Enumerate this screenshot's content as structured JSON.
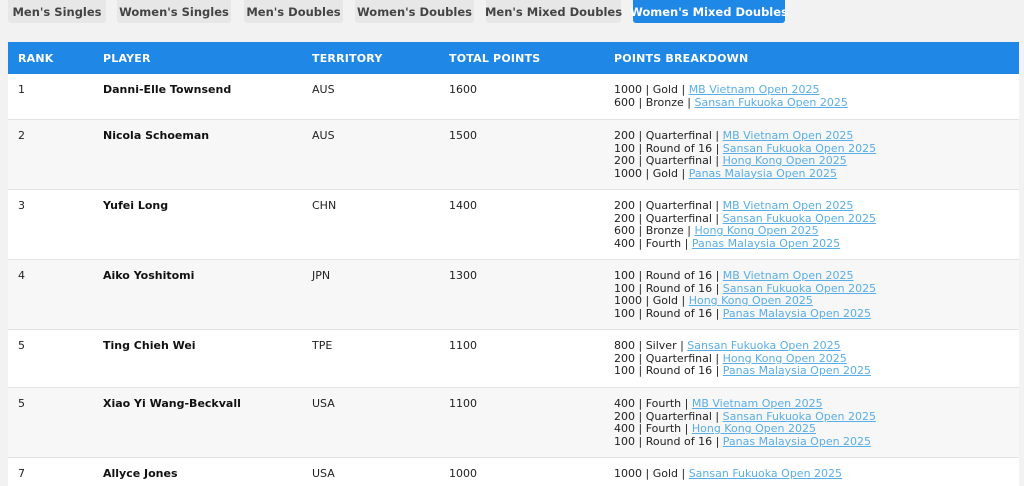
{
  "tabs": [
    {
      "label": "Men's Singles"
    },
    {
      "label": "Women's Singles"
    },
    {
      "label": "Men's Doubles"
    },
    {
      "label": "Women's Doubles"
    },
    {
      "label": "Men's Mixed Doubles"
    },
    {
      "label": "Women's Mixed Doubles"
    }
  ],
  "active_tab": "Women's Mixed Doubles",
  "colors": {
    "accent": "#1f87e5",
    "link": "#5aaee6"
  },
  "table": {
    "headers": {
      "rank": "RANK",
      "player": "PLAYER",
      "territory": "TERRITORY",
      "total_points": "TOTAL POINTS",
      "breakdown": "POINTS BREAKDOWN"
    },
    "rows": [
      {
        "rank": "1",
        "player": "Danni-Elle Townsend",
        "territory": "AUS",
        "total_points": "1600",
        "breakdown": [
          {
            "text": "1000 | Gold | ",
            "link": "MB Vietnam Open 2025"
          },
          {
            "text": "600 | Bronze | ",
            "link": "Sansan Fukuoka Open 2025"
          }
        ]
      },
      {
        "rank": "2",
        "player": "Nicola Schoeman",
        "territory": "AUS",
        "total_points": "1500",
        "breakdown": [
          {
            "text": "200 | Quarterfinal | ",
            "link": "MB Vietnam Open 2025"
          },
          {
            "text": "100 | Round of 16 | ",
            "link": "Sansan Fukuoka Open 2025"
          },
          {
            "text": "200 | Quarterfinal | ",
            "link": "Hong Kong Open 2025"
          },
          {
            "text": "1000 | Gold | ",
            "link": "Panas Malaysia Open 2025"
          }
        ]
      },
      {
        "rank": "3",
        "player": "Yufei Long",
        "territory": "CHN",
        "total_points": "1400",
        "breakdown": [
          {
            "text": "200 | Quarterfinal | ",
            "link": "MB Vietnam Open 2025"
          },
          {
            "text": "200 | Quarterfinal | ",
            "link": "Sansan Fukuoka Open 2025"
          },
          {
            "text": "600 | Bronze | ",
            "link": "Hong Kong Open 2025"
          },
          {
            "text": "400 | Fourth | ",
            "link": "Panas Malaysia Open 2025"
          }
        ]
      },
      {
        "rank": "4",
        "player": "Aiko Yoshitomi",
        "territory": "JPN",
        "total_points": "1300",
        "breakdown": [
          {
            "text": "100 | Round of 16 | ",
            "link": "MB Vietnam Open 2025"
          },
          {
            "text": "100 | Round of 16 | ",
            "link": "Sansan Fukuoka Open 2025"
          },
          {
            "text": "1000 | Gold | ",
            "link": "Hong Kong Open 2025"
          },
          {
            "text": "100 | Round of 16 | ",
            "link": "Panas Malaysia Open 2025"
          }
        ]
      },
      {
        "rank": "5",
        "player": "Ting Chieh Wei",
        "territory": "TPE",
        "total_points": "1100",
        "breakdown": [
          {
            "text": "800 | Silver | ",
            "link": "Sansan Fukuoka Open 2025"
          },
          {
            "text": "200 | Quarterfinal | ",
            "link": "Hong Kong Open 2025"
          },
          {
            "text": "100 | Round of 16 | ",
            "link": "Panas Malaysia Open 2025"
          }
        ]
      },
      {
        "rank": "5",
        "player": "Xiao Yi Wang-Beckvall",
        "territory": "USA",
        "total_points": "1100",
        "breakdown": [
          {
            "text": "400 | Fourth | ",
            "link": "MB Vietnam Open 2025"
          },
          {
            "text": "200 | Quarterfinal | ",
            "link": "Sansan Fukuoka Open 2025"
          },
          {
            "text": "400 | Fourth | ",
            "link": "Hong Kong Open 2025"
          },
          {
            "text": "100 | Round of 16 | ",
            "link": "Panas Malaysia Open 2025"
          }
        ]
      },
      {
        "rank": "7",
        "player": "Allyce Jones",
        "territory": "USA",
        "total_points": "1000",
        "breakdown": [
          {
            "text": "1000 | Gold | ",
            "link": "Sansan Fukuoka Open 2025"
          }
        ]
      }
    ]
  }
}
